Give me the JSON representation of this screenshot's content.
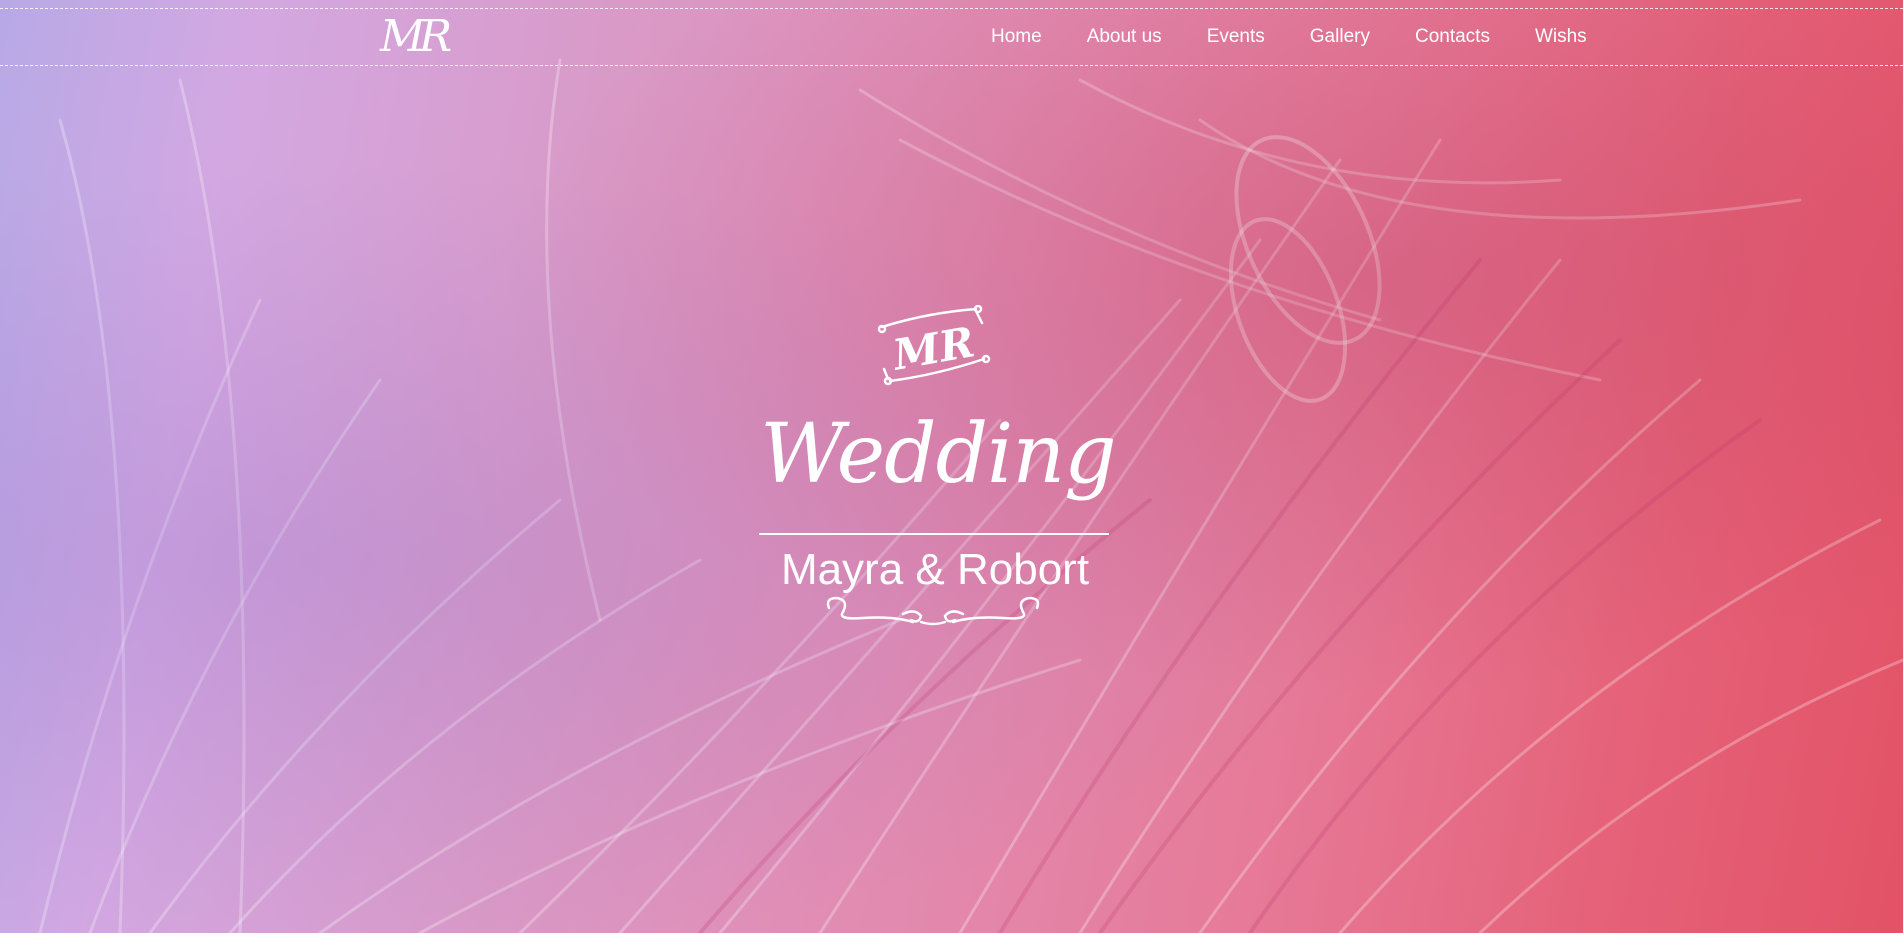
{
  "header": {
    "logo_text": "MR",
    "nav": [
      {
        "label": "Home"
      },
      {
        "label": "About us"
      },
      {
        "label": "Events"
      },
      {
        "label": "Gallery"
      },
      {
        "label": "Contacts"
      },
      {
        "label": "Wishs"
      }
    ]
  },
  "hero": {
    "monogram": "MR",
    "title": "Wedding",
    "couple": "Mayra & Robort",
    "background_colors": [
      "#b7a9e6",
      "#d99ac8",
      "#e28bb1",
      "#e56279",
      "#e35266"
    ]
  }
}
